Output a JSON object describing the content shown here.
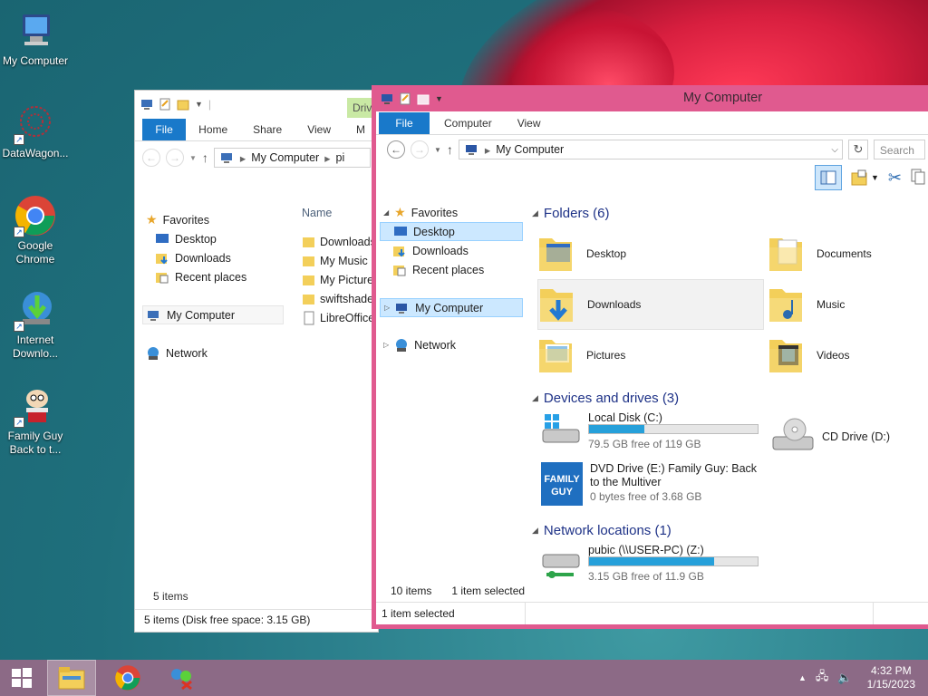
{
  "desktop": {
    "icons": [
      {
        "label": "My Computer",
        "name": "my-computer"
      },
      {
        "label": "DataWagon...",
        "name": "datawagon"
      },
      {
        "label": "Google Chrome",
        "name": "google-chrome"
      },
      {
        "label": "Internet Downlo...",
        "name": "internet-download-manager"
      },
      {
        "label": "Family Guy Back to t...",
        "name": "family-guy"
      }
    ]
  },
  "back_window": {
    "tabs": [
      "File",
      "Home",
      "Share",
      "View",
      "M"
    ],
    "context_tab": "Driv",
    "address": "My Computer",
    "address_tail": "pi",
    "nav": {
      "favorites": "Favorites",
      "desktop": "Desktop",
      "downloads": "Downloads",
      "recent": "Recent places",
      "computer": "My Computer",
      "network": "Network"
    },
    "column_name": "Name",
    "files": [
      "Downloads",
      "My Music",
      "My Pictures",
      "swiftshader",
      "LibreOffice"
    ],
    "item_count": "5 items",
    "status": "5 items (Disk free space: 3.15 GB)"
  },
  "front_window": {
    "title": "My Computer",
    "title_color": "#e05a8f",
    "tabs": [
      "File",
      "Computer",
      "View"
    ],
    "address": "My Computer",
    "search_placeholder": "Search",
    "nav": {
      "favorites": "Favorites",
      "desktop": "Desktop",
      "downloads": "Downloads",
      "recent": "Recent places",
      "computer": "My Computer",
      "network": "Network"
    },
    "folders_header": "Folders (6)",
    "folders": [
      "Desktop",
      "Documents",
      "Downloads",
      "Music",
      "Pictures",
      "Videos"
    ],
    "devices_header": "Devices and drives (3)",
    "drives": {
      "c_name": "Local Disk (C:)",
      "c_free": "79.5 GB free of 119 GB",
      "c_used_fraction": 0.33,
      "d_name": "CD Drive (D:)",
      "e_name": "DVD Drive (E:) Family Guy: Back to the Multiver",
      "e_free": "0 bytes free of 3.68 GB"
    },
    "network_header": "Network locations (1)",
    "network_drive": {
      "name": "pubic (\\\\USER-PC) (Z:)",
      "free": "3.15 GB free of 11.9 GB",
      "used_fraction": 0.74
    },
    "status_count": "10 items",
    "status_selected": "1 item selected",
    "status_bottom": "1 item selected"
  },
  "taskbar": {
    "time": "4:32 PM",
    "date": "1/15/2023",
    "color": "#8c6a86"
  }
}
